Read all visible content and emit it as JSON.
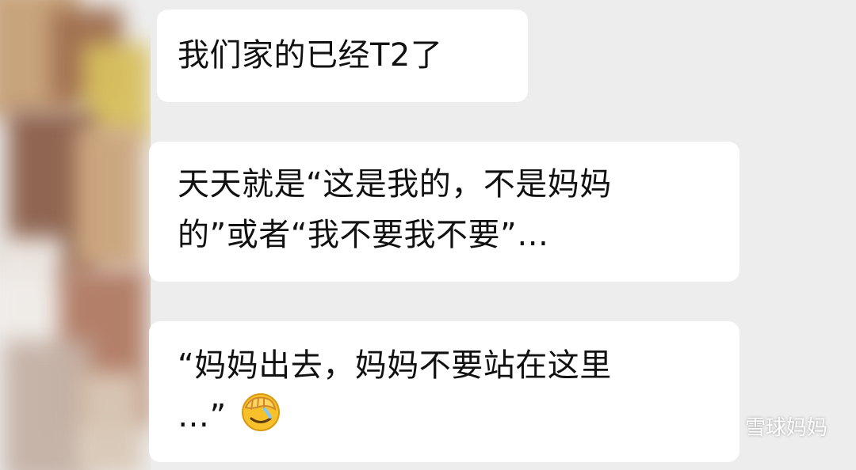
{
  "messages": [
    {
      "lines": [
        "我们家的已经T2了"
      ]
    },
    {
      "lines": [
        "天天就是“这是我的，不是妈妈",
        "的”或者“我不要我不要”…"
      ]
    },
    {
      "lines": [
        "“妈妈出去，妈妈不要站在这里",
        "…”"
      ],
      "trailing_emoji": "facepalm-emoji"
    }
  ],
  "watermark": {
    "icon": "wechat-icon",
    "text": "雪球妈妈"
  },
  "colors": {
    "background": "#ededed",
    "bubble": "#ffffff",
    "text": "#111111"
  }
}
